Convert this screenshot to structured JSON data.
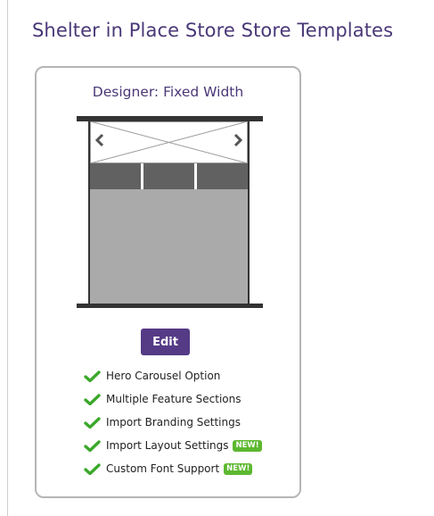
{
  "page": {
    "title": "Shelter in Place Store Store Templates"
  },
  "template_card": {
    "title": "Designer: Fixed Width",
    "edit_label": "Edit",
    "features": [
      {
        "label": "Hero Carousel Option",
        "badge": ""
      },
      {
        "label": "Multiple Feature Sections",
        "badge": ""
      },
      {
        "label": "Import Branding Settings",
        "badge": ""
      },
      {
        "label": "Import Layout Settings",
        "badge": "NEW!"
      },
      {
        "label": "Custom Font Support",
        "badge": "NEW!"
      }
    ]
  },
  "colors": {
    "title_purple": "#4a3877",
    "button_purple": "#553a86",
    "check_green": "#3aa82a",
    "badge_green": "#5cb82f"
  },
  "icons": {
    "check": "check-icon",
    "prev": "chevron-left-icon",
    "next": "chevron-right-icon"
  }
}
